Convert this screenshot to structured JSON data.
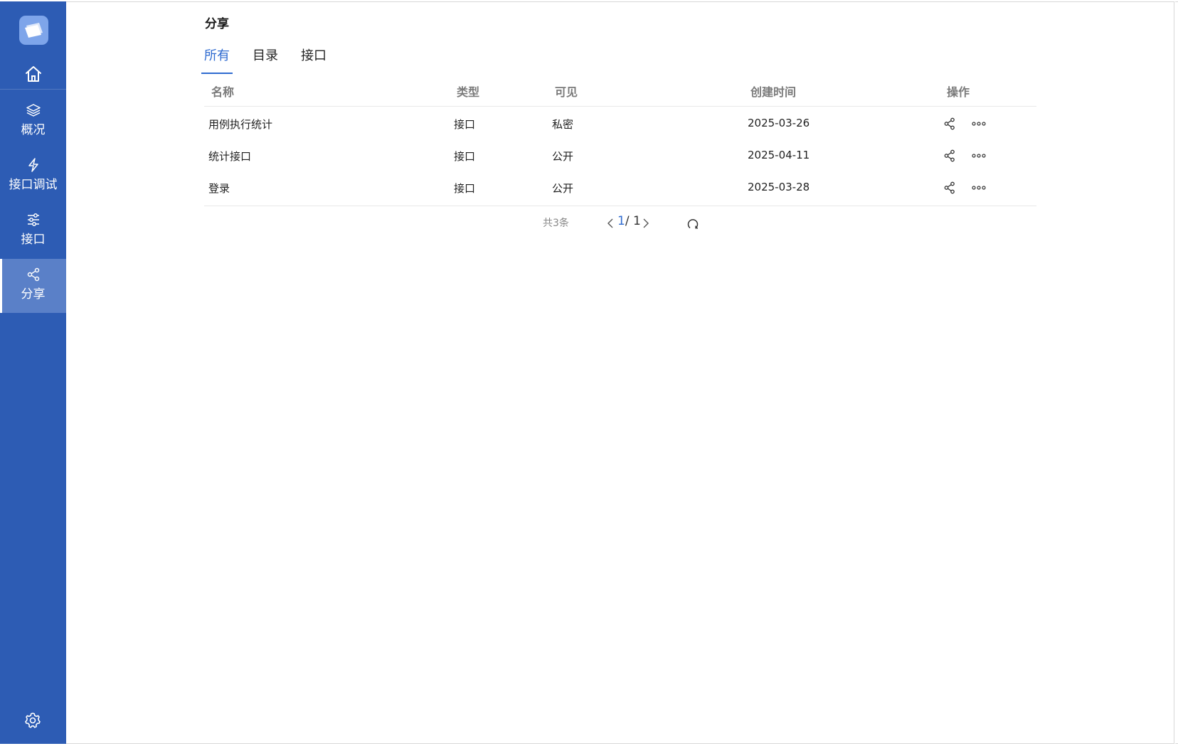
{
  "sidebar": {
    "items": [
      {
        "label": "概况",
        "icon": "layers-icon"
      },
      {
        "label": "接口调试",
        "icon": "lightning-icon"
      },
      {
        "label": "接口",
        "icon": "sliders-icon"
      },
      {
        "label": "分享",
        "icon": "share-icon",
        "active": true
      }
    ]
  },
  "page": {
    "title": "分享"
  },
  "tabs": [
    {
      "label": "所有",
      "active": true
    },
    {
      "label": "目录"
    },
    {
      "label": "接口"
    }
  ],
  "table": {
    "columns": [
      "名称",
      "类型",
      "可见",
      "创建时间",
      "操作"
    ],
    "rows": [
      {
        "name": "用例执行统计",
        "type": "接口",
        "visibility": "私密",
        "created": "2025-03-26"
      },
      {
        "name": "统计接口",
        "type": "接口",
        "visibility": "公开",
        "created": "2025-04-11"
      },
      {
        "name": "登录",
        "type": "接口",
        "visibility": "公开",
        "created": "2025-03-28"
      }
    ]
  },
  "pagination": {
    "total": "共3条",
    "current": "1",
    "separator": "/ 1"
  },
  "colors": {
    "sidebar": "#2d5cb4",
    "sidebar_active": "#5a80c8",
    "accent": "#2f6bd0"
  }
}
